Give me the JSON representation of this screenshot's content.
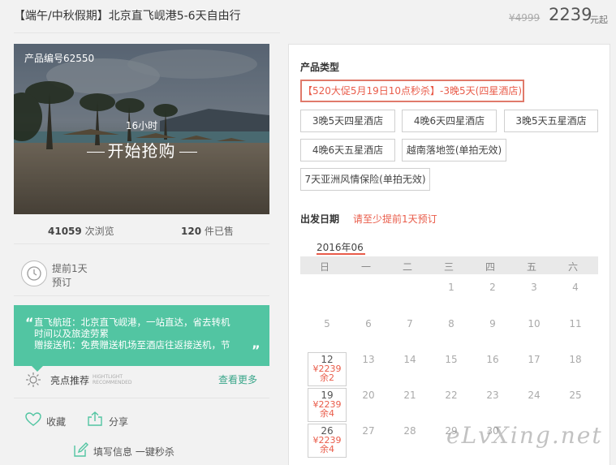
{
  "header": {
    "title": "【端午/中秋假期】北京直飞岘港5-6天自由行",
    "old_price": "¥4999",
    "price": "2239",
    "price_unit": "元起"
  },
  "hero": {
    "product_code": "产品编号62550",
    "timer": "16小时",
    "cta": "开始抢购"
  },
  "stats": {
    "views_num": "41059",
    "views_label": "次浏览",
    "sold_num": "120",
    "sold_label": "件已售"
  },
  "advance": {
    "line1": "提前1天",
    "line2": "预订"
  },
  "feature": {
    "open_quote": "“",
    "close_quote": "”",
    "lines": [
      "直飞航班：北京直飞岘港，一站直达，省去转机",
      "时间以及旅途劳累",
      "赠接送机：免费赠送机场至酒店往返接送机，节"
    ]
  },
  "highlight": {
    "label": "亮点推荐",
    "sub1": "HIGHTLIGHT",
    "sub2": "RECOMMENDED",
    "more": "查看更多"
  },
  "actions": {
    "favorite": "收藏",
    "share": "分享",
    "fill_info": "填写信息 一键秒杀"
  },
  "product_type": {
    "title": "产品类型",
    "options": [
      "【520大促5月19日10点秒杀】-3晚5天(四星酒店)",
      "3晚5天四星酒店",
      "4晚6天四星酒店",
      "3晚5天五星酒店",
      "4晚6天五星酒店",
      "越南落地签(单拍无效)",
      "7天亚洲风情保险(单拍无效)"
    ]
  },
  "departure": {
    "title": "出发日期",
    "hint": "请至少提前1天预订",
    "month": "2016年06",
    "weekdays": [
      "日",
      "一",
      "二",
      "三",
      "四",
      "五",
      "六"
    ],
    "row1": [
      "1",
      "2",
      "3",
      "4"
    ],
    "row2": [
      "5",
      "6",
      "7",
      "8",
      "9",
      "10",
      "11"
    ],
    "row3": [
      "13",
      "14",
      "15",
      "16",
      "17",
      "18"
    ],
    "row4": [
      "20",
      "21",
      "22",
      "23",
      "24",
      "25"
    ],
    "row5": [
      "27",
      "28",
      "29",
      "30"
    ],
    "avail": [
      {
        "day": "12",
        "price": "¥2239",
        "left": "余2"
      },
      {
        "day": "19",
        "price": "¥2239",
        "left": "余4"
      },
      {
        "day": "26",
        "price": "¥2239",
        "left": "余4"
      }
    ]
  },
  "watermark": "eLvXing.net"
}
